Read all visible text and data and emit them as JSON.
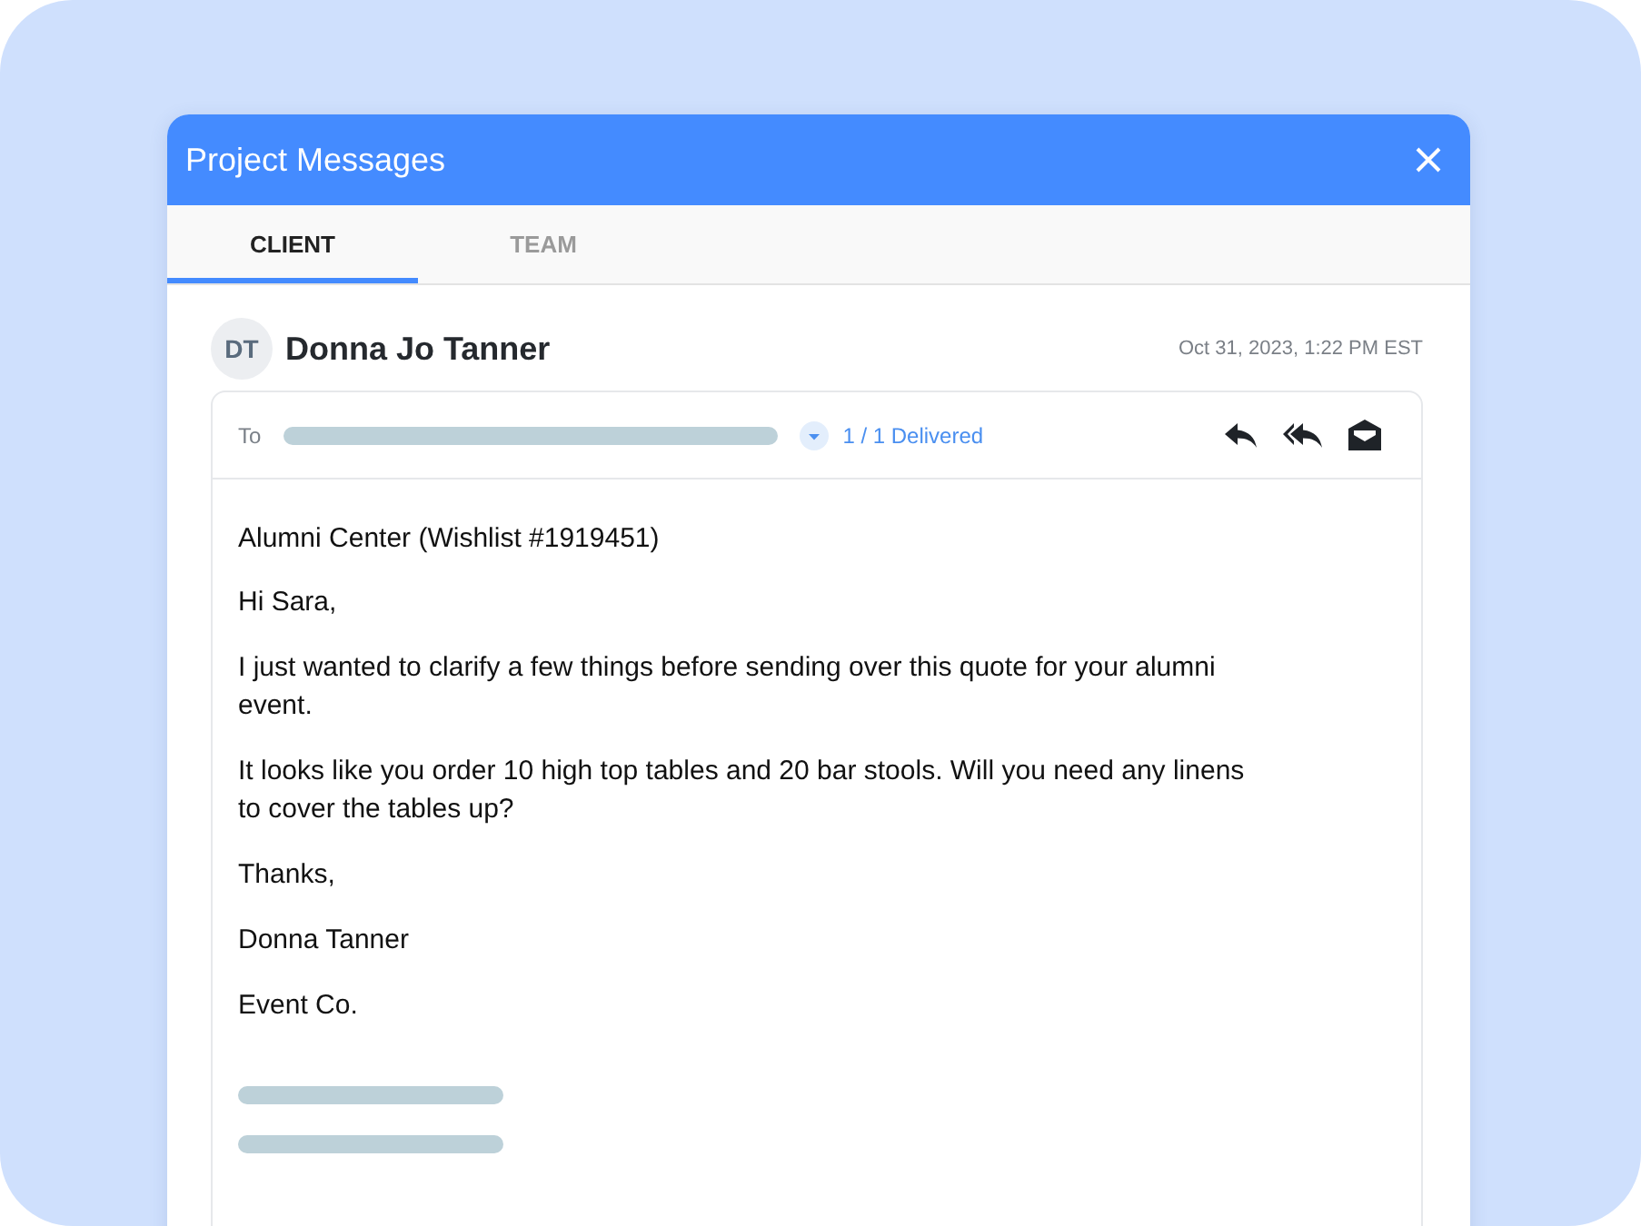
{
  "window": {
    "title": "Project Messages"
  },
  "tabs": [
    {
      "label": "CLIENT",
      "selected": true
    },
    {
      "label": "TEAM",
      "selected": false
    }
  ],
  "message": {
    "avatar": "DT",
    "sender": "Donna Jo Tanner",
    "timestamp": "Oct 31, 2023, 1:22 PM EST",
    "to_label": "To",
    "delivery": "1 / 1 Delivered",
    "subject": "Alumni Center (Wishlist #1919451)",
    "paragraphs": [
      "Hi Sara,",
      "I just wanted to clarify a few things before sending over this quote for your alumni event.",
      "It looks like you order 10 high top tables and 20 bar stools. Will you need any linens to cover the tables up?",
      "Thanks,",
      "Donna Tanner",
      "Event Co."
    ]
  }
}
